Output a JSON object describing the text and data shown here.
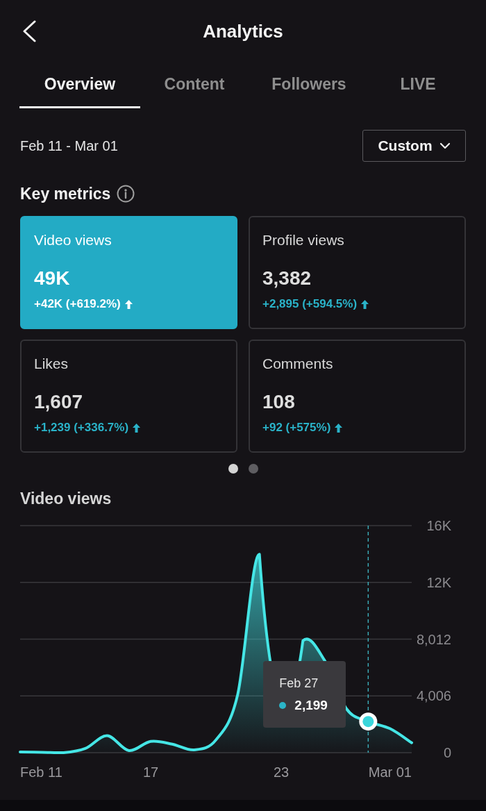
{
  "header": {
    "title": "Analytics"
  },
  "tabs": [
    {
      "label": "Overview",
      "selected": true
    },
    {
      "label": "Content",
      "selected": false
    },
    {
      "label": "Followers",
      "selected": false
    },
    {
      "label": "LIVE",
      "selected": false
    }
  ],
  "date_range": {
    "text": "Feb 11 - Mar 01",
    "dropdown": "Custom"
  },
  "key_metrics": {
    "title": "Key metrics",
    "cards": [
      {
        "label": "Video views",
        "value": "49K",
        "change": "+42K (+619.2%)",
        "rising": true,
        "selected": true
      },
      {
        "label": "Profile views",
        "value": "3,382",
        "change": "+2,895 (+594.5%)",
        "rising": true,
        "selected": false
      },
      {
        "label": "Likes",
        "value": "1,607",
        "change": "+1,239 (+336.7%)",
        "rising": true,
        "selected": false
      },
      {
        "label": "Comments",
        "value": "108",
        "change": "+92 (+575%)",
        "rising": true,
        "selected": false
      }
    ]
  },
  "pager": [
    {
      "selected": true
    },
    {
      "selected": false
    }
  ],
  "chart": {
    "tooltip": {
      "date": "Feb 27"
    },
    "chart_data": {
      "type": "area",
      "title": "Video views",
      "grid": true,
      "x": [
        11,
        12,
        13,
        14,
        15,
        16,
        17,
        18,
        19,
        20,
        21,
        22,
        23,
        24,
        25,
        26,
        27,
        28,
        29
      ],
      "xlim": [
        11,
        29
      ],
      "xticks": [
        {
          "value": 11,
          "label": "Feb 11"
        },
        {
          "value": 17,
          "label": "17"
        },
        {
          "value": 23,
          "label": "23"
        },
        {
          "value": 29,
          "label": "Mar 01"
        }
      ],
      "series": [
        {
          "color": "#45e6e6",
          "values": [
            50,
            30,
            0,
            300,
            1200,
            150,
            800,
            600,
            200,
            900,
            4100,
            14000,
            null,
            7900,
            6500,
            3100,
            2199,
            1700,
            700
          ]
        }
      ],
      "ylim": [
        0,
        16024
      ],
      "yticks": [
        {
          "value": 0,
          "label": "0"
        },
        {
          "value": 4006,
          "label": "4,006"
        },
        {
          "value": 8012,
          "label": "8,012"
        },
        {
          "value": 12018,
          "label": "12K"
        },
        {
          "value": 16024,
          "label": "16K"
        }
      ],
      "ref_lines": [
        {
          "axis": "x",
          "value": 27
        }
      ],
      "annotations": [
        "2,199"
      ]
    }
  }
}
